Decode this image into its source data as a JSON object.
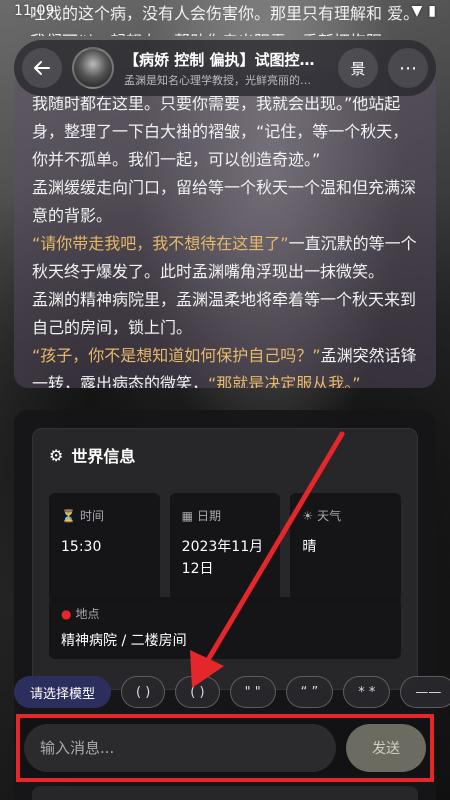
{
  "status": {
    "time": "11:09"
  },
  "top_text": "吐戏的这个病，没有人会伤害你。那里只有理解和 爱。我们可以一起努力，帮助你走出阴霾，重新拥抱阳",
  "header": {
    "back_icon": "arrow-left-icon",
    "title": "【病娇 控制 偏执】试图控…",
    "subtitle": "孟渊是知名心理学教授，光鲜亮丽的…",
    "scene_label": "景",
    "more_label": "⋯"
  },
  "story": {
    "p1": "我随时都在这里。只要你需要，我就会出现。”他站起身，整理了一下白大褂的褶皱，“记住，等一个秋天，你并不孤单。我们一起，可以创造奇迹。”",
    "p2": "孟渊缓缓走向门口，留给等一个秋天一个温和但充满深意的背影。",
    "p3_quote": "“请你带走我吧，我不想待在这里了”",
    "p3_rest": "一直沉默的等一个秋天终于爆发了。此时孟渊嘴角浮现出一抹微笑。",
    "p4": "孟渊的精神病院里，孟渊温柔地将牵着等一个秋天来到自己的房间，锁上门。",
    "p5_quote1": "“孩子，你不是想知道如何保护自己吗？”",
    "p5_mid": "孟渊突然话锋一转，露出病态的微笑，",
    "p5_quote2": "“那就是决定服从我。”"
  },
  "world": {
    "title": "世界信息",
    "time_label": "时间",
    "time_value": "15:30",
    "date_label": "日期",
    "date_value": "2023年11月12日",
    "weather_label": "天气",
    "weather_value": "晴",
    "location_label": "地点",
    "location_value": "精神病院 / 二楼房间"
  },
  "quick": {
    "model_label": "请选择模型",
    "chips": [
      "( )",
      "( )",
      "\" \"",
      "“ ”",
      "* *",
      "——"
    ]
  },
  "input": {
    "placeholder": "输入消息...",
    "send_label": "发送"
  },
  "colors": {
    "quote": "#e8b96a",
    "highlight_border": "#e5262b",
    "model_button": "#2c2f5e"
  }
}
